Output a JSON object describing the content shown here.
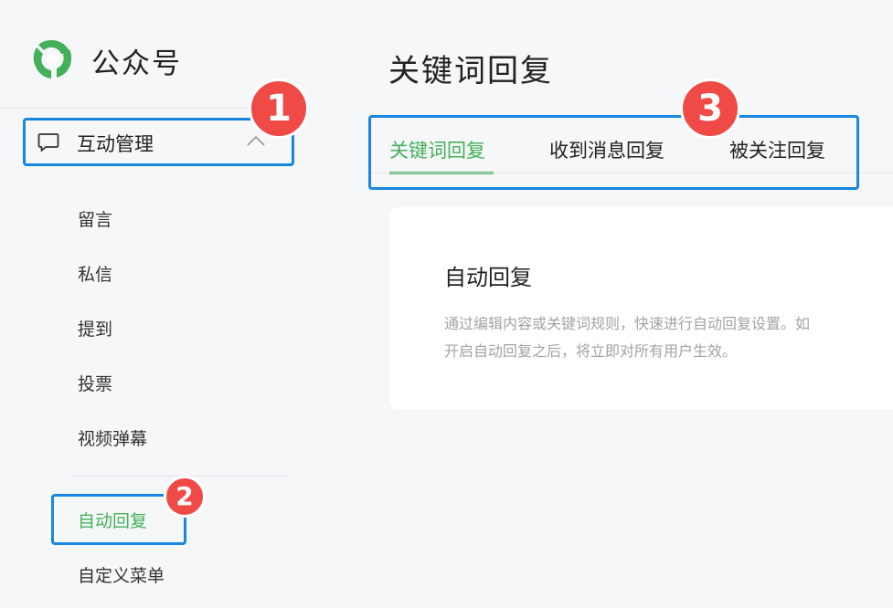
{
  "brand": {
    "name": "公众号",
    "accent_color": "#44b05a"
  },
  "sidebar": {
    "group": {
      "label": "互动管理",
      "icon": "chat-bubble-icon",
      "expand_icon": "chevron-up-icon"
    },
    "items": [
      "留言",
      "私信",
      "提到",
      "投票",
      "视频弹幕"
    ],
    "active_item": "自动回复",
    "after_active": "自定义菜单"
  },
  "main": {
    "title": "关键词回复",
    "tabs": [
      {
        "label": "关键词回复",
        "active": true
      },
      {
        "label": "收到消息回复",
        "active": false
      },
      {
        "label": "被关注回复",
        "active": false
      }
    ],
    "card": {
      "title": "自动回复",
      "desc_line1": "通过编辑内容或关键词规则，快速进行自动回复设置。如",
      "desc_line2": "开启自动回复之后，将立即对所有用户生效。"
    }
  },
  "annotations": {
    "highlight_color": "#1787e3",
    "badge_color": "#f04a47",
    "badges": [
      "1",
      "2",
      "3"
    ]
  }
}
